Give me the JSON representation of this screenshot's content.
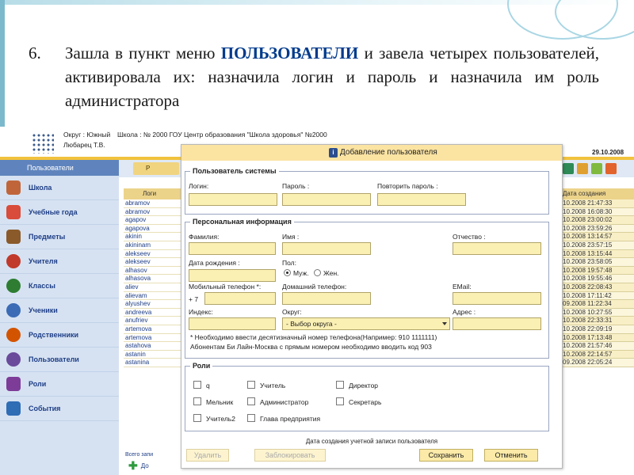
{
  "slide": {
    "number": "6.",
    "text_before": "Зашла в пункт меню ",
    "highlight": "ПОЛЬЗОВАТЕЛИ",
    "text_after": " и завела четырех пользователей, активировала их: назначила логин и пароль и назначила им  роль администратора"
  },
  "app": {
    "okrug_line": "Округ : Южный",
    "user_name": "Любарец Т.В.",
    "school_line": "Школа : № 2000 ГОУ Центр образования \"Школа здоровья\" №2000",
    "date": "29.10.2008"
  },
  "sidebar": {
    "title": "Пользователи",
    "items": [
      {
        "label": "Школа",
        "icon": "school-icon",
        "color": "#c0653a"
      },
      {
        "label": "Учебные года",
        "icon": "calendar-icon",
        "color": "#d94b3a"
      },
      {
        "label": "Предметы",
        "icon": "books-icon",
        "color": "#8a5a2a"
      },
      {
        "label": "Учителя",
        "icon": "teacher-icon",
        "color": "#c0392b"
      },
      {
        "label": "Классы",
        "icon": "class-icon",
        "color": "#2e7d32"
      },
      {
        "label": "Ученики",
        "icon": "student-icon",
        "color": "#3b6bb5"
      },
      {
        "label": "Родственники",
        "icon": "relatives-icon",
        "color": "#d35400"
      },
      {
        "label": "Пользователи",
        "icon": "users-icon",
        "color": "#6a4a9a"
      },
      {
        "label": "Роли",
        "icon": "mask-icon",
        "color": "#7d3c98"
      },
      {
        "label": "События",
        "icon": "events-icon",
        "color": "#2f6db5"
      }
    ]
  },
  "bglist": {
    "tab_label": "Р",
    "login_header": "Логи",
    "logins": [
      "abramov",
      "abramov",
      "agapov",
      "agapova",
      "akinin",
      "akininam",
      "alekseev",
      "alekseev",
      "alhasov",
      "alhasova",
      "aliev",
      "alievam",
      "alyushev",
      "andreeva",
      "anufriev",
      "artemova",
      "artemova",
      "astahova",
      "astanin",
      "astanina"
    ],
    "date_header": "Дата создания",
    "dates": [
      "10.2008 21:47:33",
      "10.2008 16:08:30",
      "10.2008 23:00:02",
      "10.2008 23:59:26",
      "10.2008 13:14:57",
      "10.2008 23:57:15",
      "10.2008 13:15:44",
      "10.2008 23:58:05",
      "10.2008 19:57:48",
      "10.2008 19:55:46",
      "10.2008 22:08:43",
      "10.2008 17:11:42",
      "09.2008 11:22:34",
      "10.2008 10:27:55",
      "10.2008 22:33:31",
      "10.2008 22:09:19",
      "10.2008 17:13:48",
      "10.2008 21:57:46",
      "10.2008 22:14:57",
      "09.2008 22:05:24"
    ],
    "total_label": "Всего запи",
    "add_label": "До"
  },
  "dialog": {
    "title": "Добавление пользователя",
    "system_user": {
      "legend": "Пользователь системы",
      "login_label": "Логин:",
      "password_label": "Пароль :",
      "repeat_label": "Повторить пароль :"
    },
    "personal": {
      "legend": "Персональная информация",
      "surname_label": "Фамилия:",
      "name_label": "Имя :",
      "patronymic_label": "Отчество :",
      "birth_label": "Дата рождения :",
      "gender_label": "Пол:",
      "male_label": "Муж.",
      "female_label": "Жен.",
      "mobile_label": "Мобильный телефон *:",
      "mobile_prefix": "+ 7",
      "home_phone_label": "Домашний телефон:",
      "email_label": "EMail:",
      "index_label": "Индекс:",
      "okrug_label": "Округ:",
      "okrug_value": "- Выбор округа -",
      "address_label": "Адрес :",
      "note1": "* Необходимо ввести десятизначный номер телефона(Например: 910 1111111)",
      "note2": "Абонентам Би Лайн-Москва с прямым номером необходимо вводить код 903"
    },
    "roles": {
      "legend": "Роли",
      "q": "q",
      "teacher": "Учитель",
      "director": "Директор",
      "melnik": "Мельник",
      "admin": "Администратор",
      "secretary": "Секретарь",
      "teacher2": "Учитель2",
      "head": "Глава предприятия"
    },
    "created_label": "Дата создания учетной записи пользователя",
    "buttons": {
      "delete": "Удалить",
      "block": "Заблокировать",
      "save": "Сохранить",
      "cancel": "Отменить"
    }
  }
}
